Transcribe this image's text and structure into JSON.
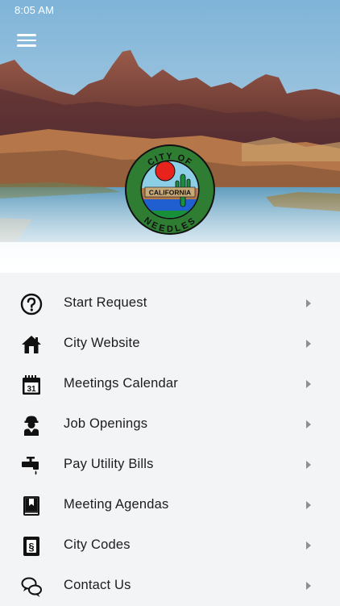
{
  "status_bar": {
    "time": "8:05 AM"
  },
  "header": {
    "menu_icon": "hamburger-menu-icon"
  },
  "seal": {
    "top_text": "CITY OF",
    "middle_text": "CALIFORNIA",
    "bottom_text": "NEEDLES",
    "colors": {
      "ring": "#2f7d32",
      "sun": "#e8231c",
      "sky": "#8ecfe8",
      "band": "#1f5fd0",
      "ground": "#1a8f3a"
    }
  },
  "menu": {
    "items": [
      {
        "label": "Start Request",
        "icon": "question-circle-icon"
      },
      {
        "label": "City Website",
        "icon": "home-icon"
      },
      {
        "label": "Meetings Calendar",
        "icon": "calendar-icon"
      },
      {
        "label": "Job Openings",
        "icon": "worker-icon"
      },
      {
        "label": "Pay Utility Bills",
        "icon": "faucet-icon"
      },
      {
        "label": "Meeting Agendas",
        "icon": "book-icon"
      },
      {
        "label": "City Codes",
        "icon": "legal-code-icon"
      },
      {
        "label": "Contact Us",
        "icon": "chat-bubbles-icon"
      }
    ],
    "calendar_day": "31"
  }
}
